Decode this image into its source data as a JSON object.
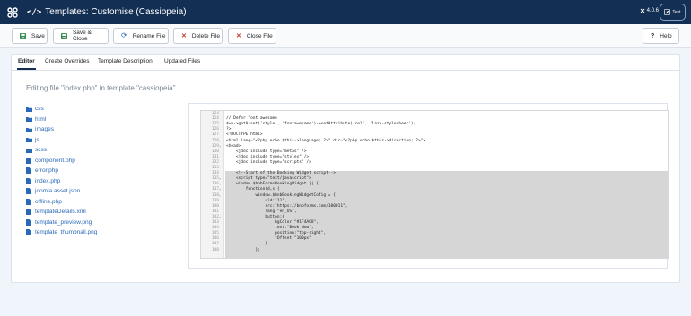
{
  "header": {
    "title": "Templates: Customise (Cassiopeia)",
    "version": "4.0.6",
    "user": "Test"
  },
  "toolbar": {
    "save": "Save",
    "save_close": "Save & Close",
    "rename": "Rename File",
    "delete": "Delete File",
    "close": "Close File",
    "help": "Help"
  },
  "tabs": [
    "Editor",
    "Create Overrides",
    "Template Description",
    "Updated Files"
  ],
  "editing_label": "Editing file \"index.php\" in template \"cassiopeia\".",
  "folders": [
    "css",
    "html",
    "images",
    "js",
    "scss"
  ],
  "files": [
    "component.php",
    "error.php",
    "index.php",
    "joomla.asset.json",
    "offline.php",
    "templateDetails.xml",
    "template_preview.png",
    "template_thumbnail.png"
  ],
  "code_lines": [
    {
      "n": "123",
      "t": ""
    },
    {
      "n": "124",
      "t": "// Defer font awesome"
    },
    {
      "n": "125",
      "t": "$wa->getAsset('style', 'fontawesome')->setAttribute('rel', 'lazy-stylesheet');"
    },
    {
      "n": "126",
      "t": "?>"
    },
    {
      "n": "127",
      "t": "<!DOCTYPE html>"
    },
    {
      "n": "128",
      "t": "<html lang=\"<?php echo $this->language; ?>\" dir=\"<?php echo $this->direction; ?>\">"
    },
    {
      "n": "129",
      "t": "<head>"
    },
    {
      "n": "130",
      "t": "    <jdoc:include type=\"metas\" />"
    },
    {
      "n": "131",
      "t": "    <jdoc:include type=\"styles\" />"
    },
    {
      "n": "132",
      "t": "    <jdoc:include type=\"scripts\" />"
    },
    {
      "n": "133",
      "t": ""
    },
    {
      "n": "134",
      "t": "    <!--Start of the Booking Widget script-->"
    },
    {
      "n": "135",
      "t": "    <script type=\"text/javascript\">"
    },
    {
      "n": "136",
      "t": "    window.$bnbFormsBookingWidget || {"
    },
    {
      "n": "137",
      "t": "        function(d,s){"
    },
    {
      "n": "138",
      "t": "            window.$bnbBookingWidgetCofig = {"
    },
    {
      "n": "139",
      "t": "                uid:\"11\","
    },
    {
      "n": "140",
      "t": "                src:\"https://bnbforms.com/100011\","
    },
    {
      "n": "141",
      "t": "                lang:\"en_US\","
    },
    {
      "n": "142",
      "t": "                button:{"
    },
    {
      "n": "143",
      "t": "                    bgColor:\"#1F4AC8\","
    },
    {
      "n": "144",
      "t": "                    text:\"Book Now\","
    },
    {
      "n": "145",
      "t": "                    position:\"top-right\","
    },
    {
      "n": "146",
      "t": "                    tOffset:\"100px\""
    },
    {
      "n": "147",
      "t": "                }"
    },
    {
      "n": "148",
      "t": "            };"
    }
  ],
  "colors": {
    "header_bg": "#132f53",
    "link": "#2a69b8",
    "save_icon": "#2d8a4a",
    "delete_icon": "#c0392b"
  }
}
